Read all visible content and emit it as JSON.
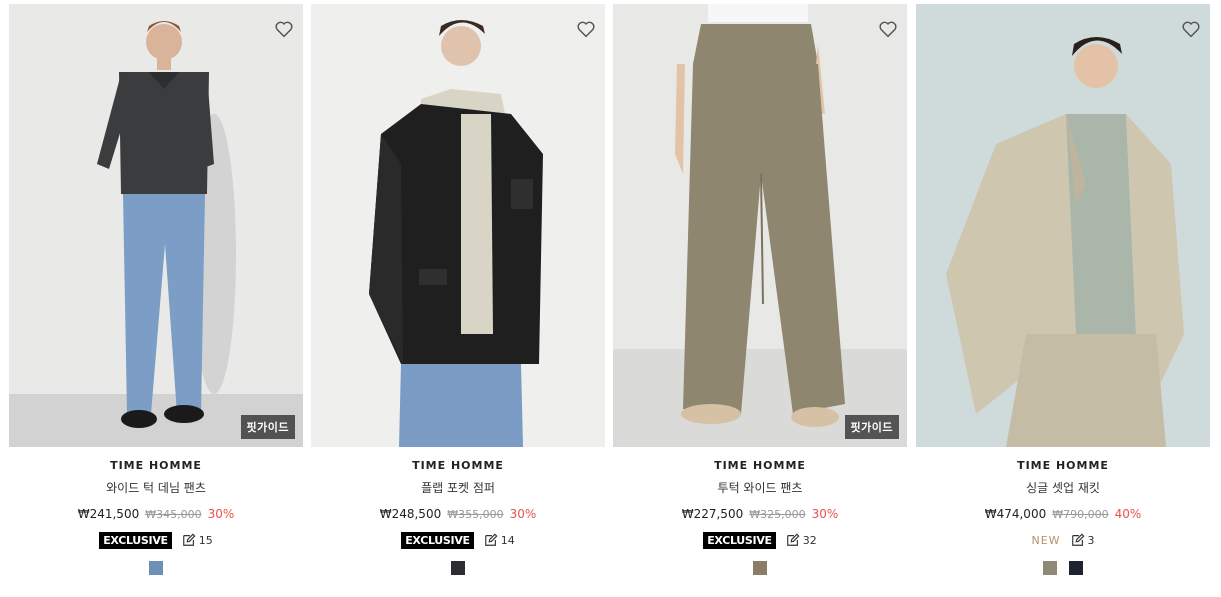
{
  "products": [
    {
      "brand": "TIME HOMME",
      "name": "와이드 턱 데님 팬츠",
      "price": "₩241,500",
      "original_price": "₩345,000",
      "discount": "30%",
      "badge": "EXCLUSIVE",
      "review_count": "15",
      "fit_guide": "핏가이드",
      "swatches": [
        "#6f8fb5"
      ]
    },
    {
      "brand": "TIME HOMME",
      "name": "플랩 포켓 점퍼",
      "price": "₩248,500",
      "original_price": "₩355,000",
      "discount": "30%",
      "badge": "EXCLUSIVE",
      "review_count": "14",
      "swatches": [
        "#2b2d31"
      ]
    },
    {
      "brand": "TIME HOMME",
      "name": "투턱 와이드 팬츠",
      "price": "₩227,500",
      "original_price": "₩325,000",
      "discount": "30%",
      "badge": "EXCLUSIVE",
      "review_count": "32",
      "fit_guide": "핏가이드",
      "swatches": [
        "#8a7d68"
      ]
    },
    {
      "brand": "TIME HOMME",
      "name": "싱글 셋업 재킷",
      "price": "₩474,000",
      "original_price": "₩790,000",
      "discount": "40%",
      "badge": "NEW",
      "review_count": "3",
      "swatches": [
        "#8f8a76",
        "#1e2230"
      ]
    }
  ]
}
